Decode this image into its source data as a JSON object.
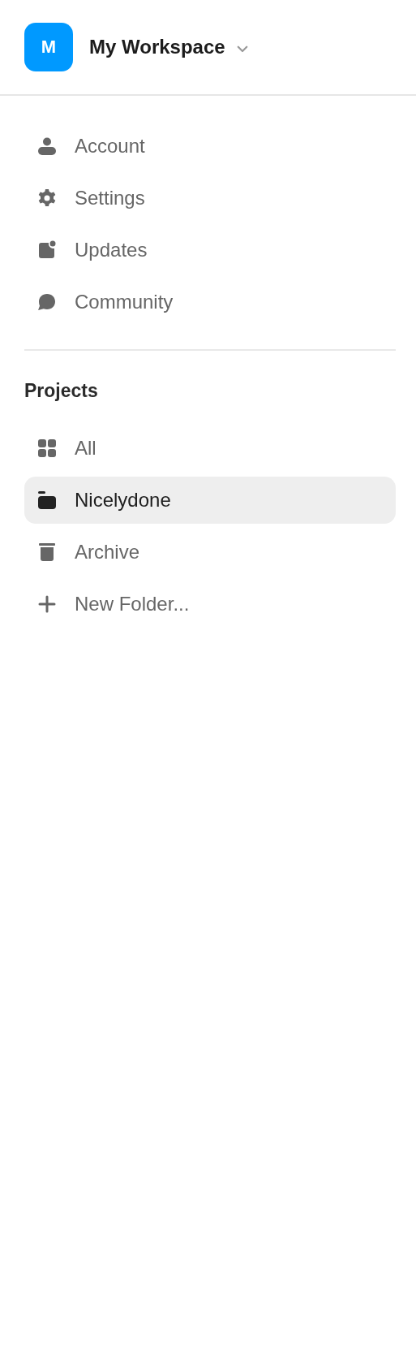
{
  "workspace": {
    "avatar_letter": "M",
    "name": "My Workspace"
  },
  "menu": [
    {
      "label": "Account"
    },
    {
      "label": "Settings"
    },
    {
      "label": "Updates"
    },
    {
      "label": "Community"
    }
  ],
  "projects": {
    "heading": "Projects",
    "items": [
      {
        "label": "All",
        "selected": false
      },
      {
        "label": "Nicelydone",
        "selected": true
      },
      {
        "label": "Archive",
        "selected": false
      }
    ],
    "new_folder": "New Folder..."
  }
}
